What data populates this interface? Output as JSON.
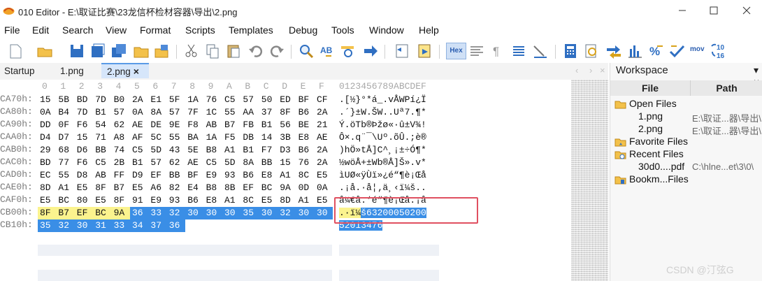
{
  "window": {
    "title": "010 Editor - E:\\取证比赛\\23龙信杯检材容器\\导出\\2.png"
  },
  "menu": [
    "File",
    "Edit",
    "Search",
    "View",
    "Format",
    "Scripts",
    "Templates",
    "Debug",
    "Tools",
    "Window",
    "Help"
  ],
  "toolbar": {
    "hex_label": "Hex",
    "mov_label": "mov",
    "radix_top": "10",
    "radix_bottom": "16"
  },
  "tabs": {
    "startup": "Startup",
    "file1": "1.png",
    "file2": "2.png",
    "close": "×"
  },
  "hex": {
    "column_header": "0 1 2 3 4 5 6 7 8 9 A B C D E F",
    "char_header": "0123456789ABCDEF",
    "rows": [
      {
        "addr": "CA70h:",
        "bytes": [
          "15",
          "5B",
          "BD",
          "7D",
          "B0",
          "2A",
          "E1",
          "5F",
          "1A",
          "76",
          "C5",
          "57",
          "50",
          "ED",
          "BF",
          "CF"
        ],
        "chars": ".[½}°*á_.vÅWPí¿Ï"
      },
      {
        "addr": "CA80h:",
        "bytes": [
          "0A",
          "B4",
          "7D",
          "B1",
          "57",
          "0A",
          "8A",
          "57",
          "7F",
          "1C",
          "55",
          "AA",
          "37",
          "8F",
          "B6",
          "2A"
        ],
        "chars": ".´}±W.ŠW..Uª7.¶*"
      },
      {
        "addr": "CA90h:",
        "bytes": [
          "DD",
          "0F",
          "F6",
          "54",
          "62",
          "AE",
          "DE",
          "9E",
          "F8",
          "AB",
          "B7",
          "FB",
          "B1",
          "56",
          "BE",
          "21"
        ],
        "chars": "Ý.öTb®Þžø«·û±V¾!"
      },
      {
        "addr": "CAA0h:",
        "bytes": [
          "D4",
          "D7",
          "15",
          "71",
          "A8",
          "AF",
          "5C",
          "55",
          "BA",
          "1A",
          "F5",
          "DB",
          "14",
          "3B",
          "E8",
          "AE"
        ],
        "chars": "Ô×.q¨¯\\Uº.õÛ.;è®"
      },
      {
        "addr": "CAB0h:",
        "bytes": [
          "29",
          "68",
          "D6",
          "BB",
          "74",
          "C5",
          "5D",
          "43",
          "5E",
          "B8",
          "A1",
          "B1",
          "F7",
          "D3",
          "B6",
          "2A"
        ],
        "chars": ")hÖ»tÅ]C^¸¡±÷Ó¶*"
      },
      {
        "addr": "CAC0h:",
        "bytes": [
          "BD",
          "77",
          "F6",
          "C5",
          "2B",
          "B1",
          "57",
          "62",
          "AE",
          "C5",
          "5D",
          "8A",
          "BB",
          "15",
          "76",
          "2A"
        ],
        "chars": "½wöÅ+±Wb®Å]Š».v*"
      },
      {
        "addr": "CAD0h:",
        "bytes": [
          "EC",
          "55",
          "D8",
          "AB",
          "FF",
          "D9",
          "EF",
          "BB",
          "BF",
          "E9",
          "93",
          "B6",
          "E8",
          "A1",
          "8C",
          "E5"
        ],
        "chars": "ìUØ«ÿÙï»¿é“¶è¡Œå"
      },
      {
        "addr": "CAE0h:",
        "bytes": [
          "8D",
          "A1",
          "E5",
          "8F",
          "B7",
          "E5",
          "A6",
          "82",
          "E4",
          "B8",
          "8B",
          "EF",
          "BC",
          "9A",
          "0D",
          "0A"
        ],
        "chars": ".¡å.·å¦‚ä¸‹ï¼š.."
      },
      {
        "addr": "CAF0h:",
        "bytes": [
          "E5",
          "BC",
          "80",
          "E5",
          "8F",
          "91",
          "E9",
          "93",
          "B6",
          "E8",
          "A1",
          "8C",
          "E5",
          "8D",
          "A1",
          "E5"
        ],
        "chars": "å¼€å.‘é“¶è¡Œå.¡å"
      },
      {
        "addr": "CB00h:",
        "bytes": [
          "8F",
          "B7",
          "EF",
          "BC",
          "9A",
          "36",
          "33",
          "32",
          "30",
          "30",
          "30",
          "35",
          "30",
          "32",
          "30",
          "30"
        ],
        "chars": ".·ï¼š63200050200"
      },
      {
        "addr": "CB10h:",
        "bytes": [
          "35",
          "32",
          "30",
          "31",
          "33",
          "34",
          "37",
          "36"
        ],
        "chars": "52013476"
      }
    ]
  },
  "workspace": {
    "title": "Workspace",
    "pin": "▾ ×",
    "col_file": "File",
    "col_path": "Path",
    "items": [
      {
        "label": "Open Files",
        "path": "",
        "level": 0,
        "icon": "folder-open-icon"
      },
      {
        "label": "1.png",
        "path": "E:\\取证...器\\导出\\",
        "level": 1,
        "icon": ""
      },
      {
        "label": "2.png",
        "path": "E:\\取证...器\\导出\\",
        "level": 1,
        "icon": ""
      },
      {
        "label": "Favorite Files",
        "path": "",
        "level": 0,
        "icon": "favorite-folder-icon"
      },
      {
        "label": "Recent Files",
        "path": "",
        "level": 0,
        "icon": "recent-folder-icon"
      },
      {
        "label": "30d0....pdf",
        "path": "C:\\hlne...et\\3\\0\\",
        "level": 1,
        "icon": ""
      },
      {
        "label": "Bookm...Files",
        "path": "",
        "level": 0,
        "icon": "bookmark-folder-icon"
      }
    ]
  },
  "watermark": "CSDN @汀弦G",
  "colors": {
    "highlight_yellow": "#fbf38e",
    "highlight_blue": "#3a8ee6",
    "annotation_red": "#e05060",
    "tab_active": "#d6e6fa"
  }
}
